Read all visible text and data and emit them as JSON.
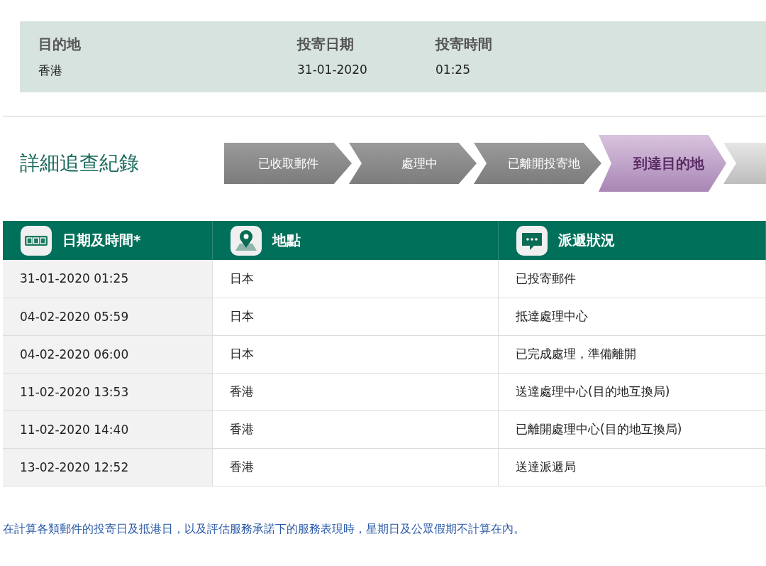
{
  "summary": {
    "columns": [
      {
        "label": "目的地",
        "value": "香港"
      },
      {
        "label": "投寄日期",
        "value": "31-01-2020"
      },
      {
        "label": "投寄時間",
        "value": "01:25"
      }
    ]
  },
  "tracking": {
    "title": "詳細追查紀錄",
    "steps": [
      {
        "label": "已收取郵件",
        "selected": false
      },
      {
        "label": "處理中",
        "selected": false
      },
      {
        "label": "已離開投寄地",
        "selected": false
      },
      {
        "label": "到達目的地",
        "selected": true
      }
    ]
  },
  "table": {
    "columns": [
      {
        "kind": "calendar",
        "label": "日期及時間*"
      },
      {
        "kind": "location",
        "label": "地點"
      },
      {
        "kind": "chat",
        "label": "派遞狀況"
      }
    ],
    "rows": [
      [
        "31-01-2020 01:25",
        "日本",
        "已投寄郵件"
      ],
      [
        "04-02-2020 05:59",
        "日本",
        "抵達處理中心"
      ],
      [
        "04-02-2020 06:00",
        "日本",
        "已完成處理，準備離開"
      ],
      [
        "11-02-2020 13:53",
        "香港",
        "送達處理中心(目的地互換局)"
      ],
      [
        "11-02-2020 14:40",
        "香港",
        "已離開處理中心(目的地互換局)"
      ],
      [
        "13-02-2020 12:52",
        "香港",
        "送達派遞局"
      ]
    ]
  },
  "footnote": "在計算各類郵件的投寄日及抵港日，以及評估服務承諾下的服務表現時，星期日及公眾假期不計算在內。"
}
